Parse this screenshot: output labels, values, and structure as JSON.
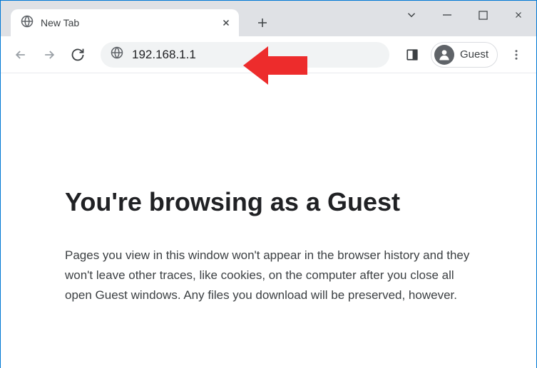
{
  "tab": {
    "title": "New Tab"
  },
  "omnibox": {
    "value": "192.168.1.1"
  },
  "profile": {
    "label": "Guest"
  },
  "page": {
    "heading": "You're browsing as a Guest",
    "body": "Pages you view in this window won't appear in the browser history and they won't leave other traces, like cookies, on the computer after you close all open Guest windows. Any files you download will be preserved, however."
  },
  "colors": {
    "annotation": "#ed2c2c"
  }
}
